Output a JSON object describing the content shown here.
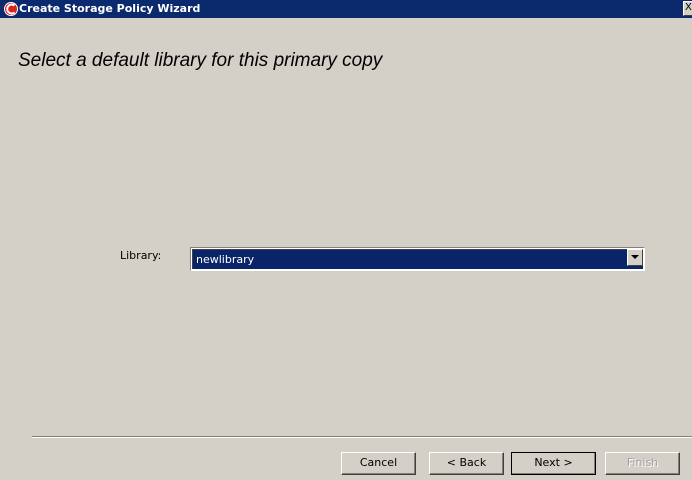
{
  "window": {
    "title": "Create Storage Policy Wizard",
    "close_glyph": "X",
    "app_icon": "commvault-logo-icon"
  },
  "main": {
    "heading": "Select a default library for this primary copy",
    "library_label": "Library:",
    "library_selected": "newlibrary"
  },
  "footer": {
    "cancel_label": "Cancel",
    "back_label": "< Back",
    "next_label": "Next >",
    "finish_label": "Finish",
    "finish_enabled": false
  },
  "colors": {
    "title_bar": "#0b2a6e",
    "window_bg": "#d4d0c8",
    "selection_bg": "#0a246a",
    "disabled_text": "#a0a0a0"
  }
}
